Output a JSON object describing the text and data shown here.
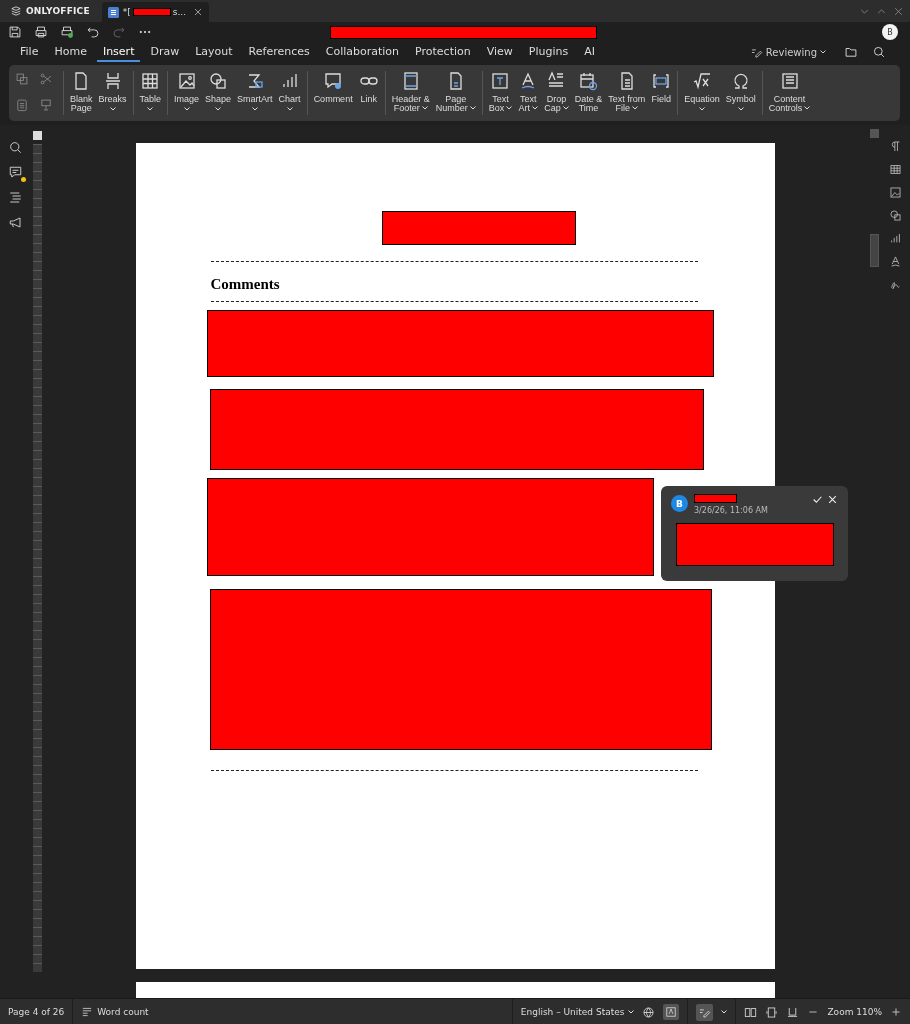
{
  "title_bar": {
    "app_name": "ONLYOFFICE",
    "doc_tab": {
      "prefix": "*[",
      "suffix": "s..."
    }
  },
  "quick_toolbar": [
    {
      "disabled": false
    },
    {
      "disabled": false
    },
    {
      "disabled": false
    },
    {
      "disabled": false
    },
    {
      "disabled": true
    },
    {
      "disabled": false
    }
  ],
  "user_avatar": "B",
  "menu": {
    "tabs": [
      {
        "label": "File",
        "selected": false
      },
      {
        "label": "Home",
        "selected": false
      },
      {
        "label": "Insert",
        "selected": true
      },
      {
        "label": "Draw",
        "selected": false
      },
      {
        "label": "Layout",
        "selected": false
      },
      {
        "label": "References",
        "selected": false
      },
      {
        "label": "Collaboration",
        "selected": false
      },
      {
        "label": "Protection",
        "selected": false
      },
      {
        "label": "View",
        "selected": false
      },
      {
        "label": "Plugins",
        "selected": false
      },
      {
        "label": "AI",
        "selected": false
      }
    ],
    "mode": "Reviewing"
  },
  "ribbon": {
    "groups": [
      [
        {
          "lines": [
            "Blank",
            "Page"
          ],
          "dropdown": false
        },
        {
          "lines": [
            "Breaks"
          ],
          "dropdown": true
        }
      ],
      [
        {
          "lines": [
            "Table"
          ],
          "dropdown": true
        }
      ],
      [
        {
          "lines": [
            "Image"
          ],
          "dropdown": true
        },
        {
          "lines": [
            "Shape"
          ],
          "dropdown": true
        },
        {
          "lines": [
            "SmartArt"
          ],
          "dropdown": true
        },
        {
          "lines": [
            "Chart"
          ],
          "dropdown": true
        }
      ],
      [
        {
          "lines": [
            "Comment"
          ],
          "dropdown": false
        },
        {
          "lines": [
            "Link"
          ],
          "dropdown": false
        }
      ],
      [
        {
          "lines": [
            "Header &",
            "Footer"
          ],
          "dropdown": true
        },
        {
          "lines": [
            "Page",
            "Number"
          ],
          "dropdown": true
        }
      ],
      [
        {
          "lines": [
            "Text",
            "Box"
          ],
          "dropdown": true
        },
        {
          "lines": [
            "Text",
            "Art"
          ],
          "dropdown": true
        },
        {
          "lines": [
            "Drop",
            "Cap"
          ],
          "dropdown": true
        },
        {
          "lines": [
            "Date &",
            "Time"
          ],
          "dropdown": false
        },
        {
          "lines": [
            "Text from",
            "File"
          ],
          "dropdown": true
        },
        {
          "lines": [
            "Field"
          ],
          "dropdown": false
        }
      ],
      [
        {
          "lines": [
            "Equation"
          ],
          "dropdown": true
        },
        {
          "lines": [
            "Symbol"
          ],
          "dropdown": true
        }
      ],
      [
        {
          "lines": [
            "Content",
            "Controls"
          ],
          "dropdown": true
        }
      ]
    ]
  },
  "left_panel": [
    {
      "badge": false
    },
    {
      "badge": true
    },
    {
      "badge": false
    },
    {
      "badge": false
    }
  ],
  "document": {
    "heading": "Comments"
  },
  "comment_popup": {
    "avatar": "B",
    "date": "3/26/26, 11:06 AM"
  },
  "status_bar": {
    "page": "Page 4 of 26",
    "word_count": "Word count",
    "language": "English – United States",
    "spellcheck_on": true,
    "track_changes_on": true,
    "zoom": "Zoom 110%"
  }
}
